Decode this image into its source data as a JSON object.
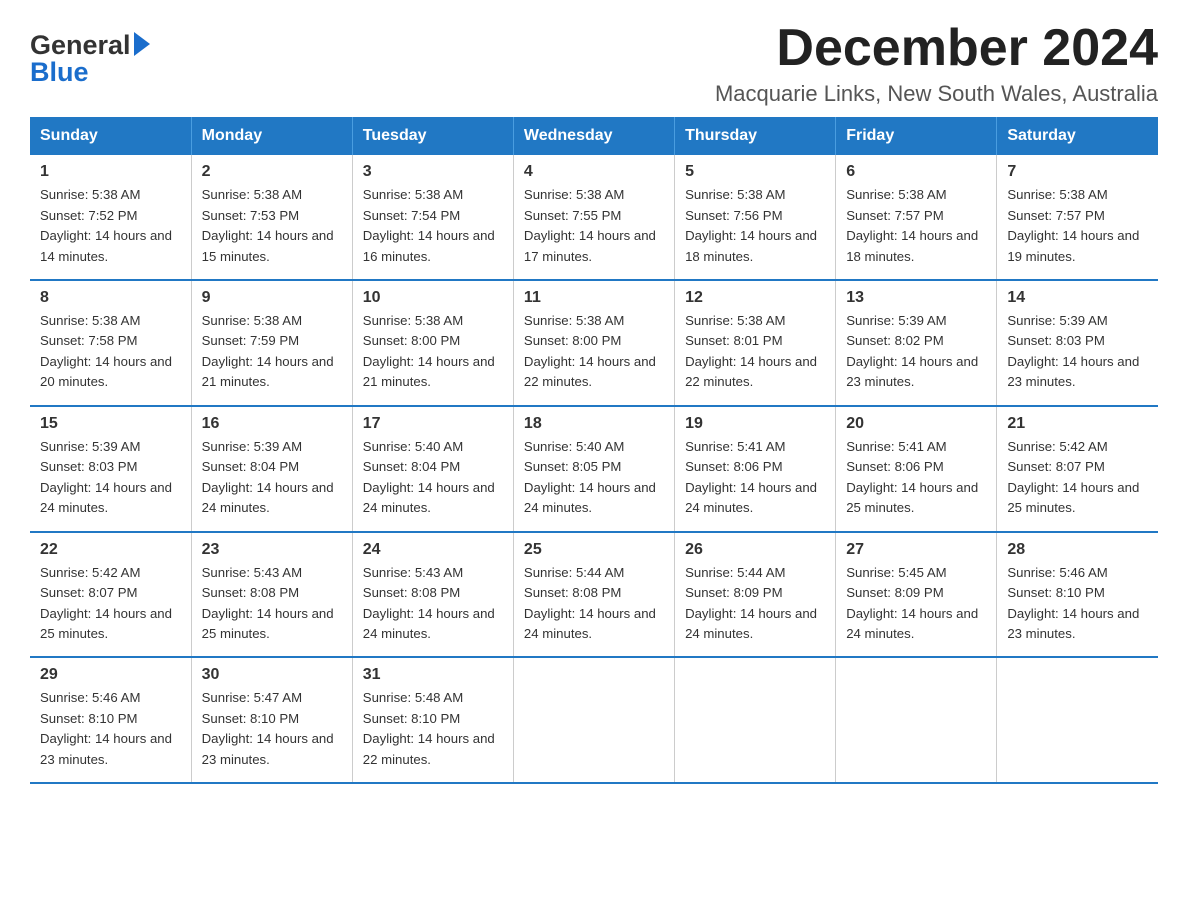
{
  "logo": {
    "general": "General",
    "blue": "Blue"
  },
  "header": {
    "title": "December 2024",
    "subtitle": "Macquarie Links, New South Wales, Australia"
  },
  "weekdays": [
    "Sunday",
    "Monday",
    "Tuesday",
    "Wednesday",
    "Thursday",
    "Friday",
    "Saturday"
  ],
  "weeks": [
    [
      {
        "day": "1",
        "sunrise": "Sunrise: 5:38 AM",
        "sunset": "Sunset: 7:52 PM",
        "daylight": "Daylight: 14 hours and 14 minutes."
      },
      {
        "day": "2",
        "sunrise": "Sunrise: 5:38 AM",
        "sunset": "Sunset: 7:53 PM",
        "daylight": "Daylight: 14 hours and 15 minutes."
      },
      {
        "day": "3",
        "sunrise": "Sunrise: 5:38 AM",
        "sunset": "Sunset: 7:54 PM",
        "daylight": "Daylight: 14 hours and 16 minutes."
      },
      {
        "day": "4",
        "sunrise": "Sunrise: 5:38 AM",
        "sunset": "Sunset: 7:55 PM",
        "daylight": "Daylight: 14 hours and 17 minutes."
      },
      {
        "day": "5",
        "sunrise": "Sunrise: 5:38 AM",
        "sunset": "Sunset: 7:56 PM",
        "daylight": "Daylight: 14 hours and 18 minutes."
      },
      {
        "day": "6",
        "sunrise": "Sunrise: 5:38 AM",
        "sunset": "Sunset: 7:57 PM",
        "daylight": "Daylight: 14 hours and 18 minutes."
      },
      {
        "day": "7",
        "sunrise": "Sunrise: 5:38 AM",
        "sunset": "Sunset: 7:57 PM",
        "daylight": "Daylight: 14 hours and 19 minutes."
      }
    ],
    [
      {
        "day": "8",
        "sunrise": "Sunrise: 5:38 AM",
        "sunset": "Sunset: 7:58 PM",
        "daylight": "Daylight: 14 hours and 20 minutes."
      },
      {
        "day": "9",
        "sunrise": "Sunrise: 5:38 AM",
        "sunset": "Sunset: 7:59 PM",
        "daylight": "Daylight: 14 hours and 21 minutes."
      },
      {
        "day": "10",
        "sunrise": "Sunrise: 5:38 AM",
        "sunset": "Sunset: 8:00 PM",
        "daylight": "Daylight: 14 hours and 21 minutes."
      },
      {
        "day": "11",
        "sunrise": "Sunrise: 5:38 AM",
        "sunset": "Sunset: 8:00 PM",
        "daylight": "Daylight: 14 hours and 22 minutes."
      },
      {
        "day": "12",
        "sunrise": "Sunrise: 5:38 AM",
        "sunset": "Sunset: 8:01 PM",
        "daylight": "Daylight: 14 hours and 22 minutes."
      },
      {
        "day": "13",
        "sunrise": "Sunrise: 5:39 AM",
        "sunset": "Sunset: 8:02 PM",
        "daylight": "Daylight: 14 hours and 23 minutes."
      },
      {
        "day": "14",
        "sunrise": "Sunrise: 5:39 AM",
        "sunset": "Sunset: 8:03 PM",
        "daylight": "Daylight: 14 hours and 23 minutes."
      }
    ],
    [
      {
        "day": "15",
        "sunrise": "Sunrise: 5:39 AM",
        "sunset": "Sunset: 8:03 PM",
        "daylight": "Daylight: 14 hours and 24 minutes."
      },
      {
        "day": "16",
        "sunrise": "Sunrise: 5:39 AM",
        "sunset": "Sunset: 8:04 PM",
        "daylight": "Daylight: 14 hours and 24 minutes."
      },
      {
        "day": "17",
        "sunrise": "Sunrise: 5:40 AM",
        "sunset": "Sunset: 8:04 PM",
        "daylight": "Daylight: 14 hours and 24 minutes."
      },
      {
        "day": "18",
        "sunrise": "Sunrise: 5:40 AM",
        "sunset": "Sunset: 8:05 PM",
        "daylight": "Daylight: 14 hours and 24 minutes."
      },
      {
        "day": "19",
        "sunrise": "Sunrise: 5:41 AM",
        "sunset": "Sunset: 8:06 PM",
        "daylight": "Daylight: 14 hours and 24 minutes."
      },
      {
        "day": "20",
        "sunrise": "Sunrise: 5:41 AM",
        "sunset": "Sunset: 8:06 PM",
        "daylight": "Daylight: 14 hours and 25 minutes."
      },
      {
        "day": "21",
        "sunrise": "Sunrise: 5:42 AM",
        "sunset": "Sunset: 8:07 PM",
        "daylight": "Daylight: 14 hours and 25 minutes."
      }
    ],
    [
      {
        "day": "22",
        "sunrise": "Sunrise: 5:42 AM",
        "sunset": "Sunset: 8:07 PM",
        "daylight": "Daylight: 14 hours and 25 minutes."
      },
      {
        "day": "23",
        "sunrise": "Sunrise: 5:43 AM",
        "sunset": "Sunset: 8:08 PM",
        "daylight": "Daylight: 14 hours and 25 minutes."
      },
      {
        "day": "24",
        "sunrise": "Sunrise: 5:43 AM",
        "sunset": "Sunset: 8:08 PM",
        "daylight": "Daylight: 14 hours and 24 minutes."
      },
      {
        "day": "25",
        "sunrise": "Sunrise: 5:44 AM",
        "sunset": "Sunset: 8:08 PM",
        "daylight": "Daylight: 14 hours and 24 minutes."
      },
      {
        "day": "26",
        "sunrise": "Sunrise: 5:44 AM",
        "sunset": "Sunset: 8:09 PM",
        "daylight": "Daylight: 14 hours and 24 minutes."
      },
      {
        "day": "27",
        "sunrise": "Sunrise: 5:45 AM",
        "sunset": "Sunset: 8:09 PM",
        "daylight": "Daylight: 14 hours and 24 minutes."
      },
      {
        "day": "28",
        "sunrise": "Sunrise: 5:46 AM",
        "sunset": "Sunset: 8:10 PM",
        "daylight": "Daylight: 14 hours and 23 minutes."
      }
    ],
    [
      {
        "day": "29",
        "sunrise": "Sunrise: 5:46 AM",
        "sunset": "Sunset: 8:10 PM",
        "daylight": "Daylight: 14 hours and 23 minutes."
      },
      {
        "day": "30",
        "sunrise": "Sunrise: 5:47 AM",
        "sunset": "Sunset: 8:10 PM",
        "daylight": "Daylight: 14 hours and 23 minutes."
      },
      {
        "day": "31",
        "sunrise": "Sunrise: 5:48 AM",
        "sunset": "Sunset: 8:10 PM",
        "daylight": "Daylight: 14 hours and 22 minutes."
      },
      null,
      null,
      null,
      null
    ]
  ]
}
